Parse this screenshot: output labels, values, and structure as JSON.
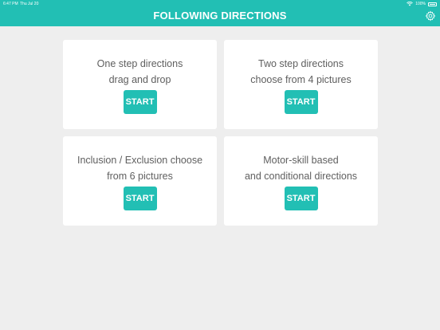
{
  "status_bar": {
    "time": "6:47 PM",
    "date": "Thu Jul 20",
    "battery": "100%",
    "wifi_icon": "wifi-icon",
    "battery_icon": "battery-icon"
  },
  "header": {
    "title": "FOLLOWING DIRECTIONS",
    "settings_icon": "gear-icon",
    "background_color": "#22bfb4"
  },
  "cards": [
    {
      "line1": "One step directions",
      "line2": "drag and drop",
      "button_label": "START"
    },
    {
      "line1": "Two step directions",
      "line2": "choose from 4 pictures",
      "button_label": "START"
    },
    {
      "line1": "Inclusion / Exclusion choose",
      "line2": "from 6 pictures",
      "button_label": "START"
    },
    {
      "line1": "Motor-skill based",
      "line2": "and conditional directions",
      "button_label": "START"
    }
  ],
  "colors": {
    "accent": "#22bfb4",
    "background": "#eeeeee",
    "card": "#ffffff",
    "card_text": "#5f5f5f"
  }
}
